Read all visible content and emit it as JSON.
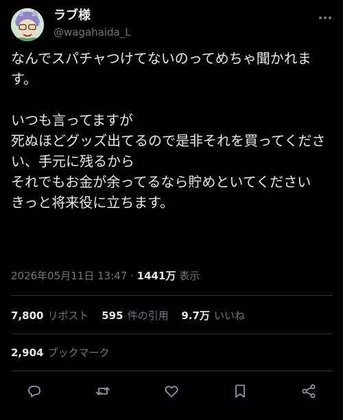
{
  "user": {
    "display_name": "ラブ様",
    "handle": "@wagahaida_L"
  },
  "tweet": {
    "text": "なんでスパチャつけてないのってめちゃ聞かれます。\n\nいつも言ってますが\n死ぬほどグッズ出てるので是非それを買ってください、手元に残るから\nそれでもお金が余ってるなら貯めといてください\nきっと将来役に立ちます。",
    "date": "2026年05月11日 13:47",
    "views_count": "1441万",
    "views_label": "表示"
  },
  "stats": {
    "reposts_count": "7,800",
    "reposts_label": "リポスト",
    "quotes_count": "595",
    "quotes_label": "件の引用",
    "likes_count": "9.7万",
    "likes_label": "いいね",
    "bookmarks_count": "2,904",
    "bookmarks_label": "ブックマーク"
  },
  "icons": [
    "more-icon",
    "reply-icon",
    "repost-icon",
    "like-icon",
    "bookmark-icon",
    "share-icon"
  ],
  "colors": {
    "background": "#000000",
    "text": "#e7e9ea",
    "secondary": "#71767b",
    "divider": "#2f3336"
  }
}
